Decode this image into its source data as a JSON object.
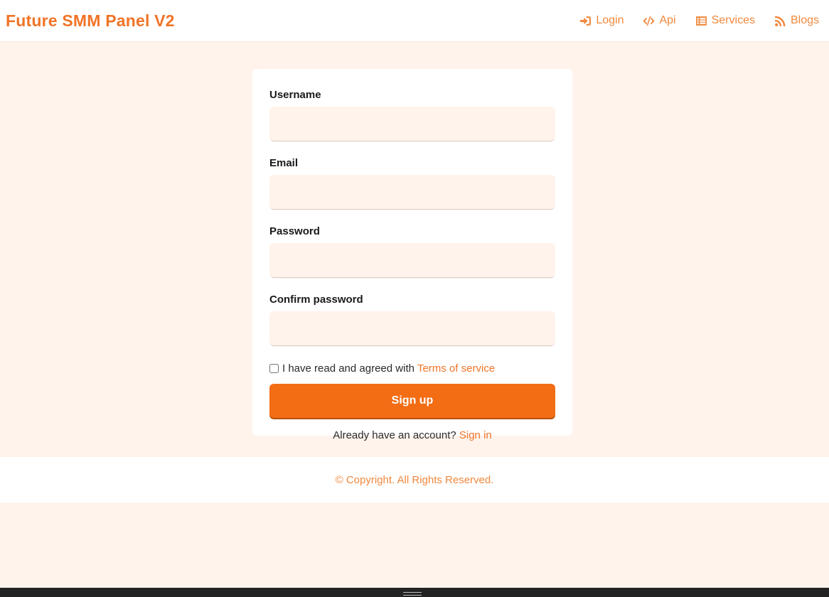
{
  "header": {
    "brand": "Future SMM Panel V2",
    "nav": [
      {
        "label": "Login",
        "icon": "sign-in-icon"
      },
      {
        "label": "Api",
        "icon": "code-icon"
      },
      {
        "label": "Services",
        "icon": "list-icon"
      },
      {
        "label": "Blogs",
        "icon": "rss-icon"
      }
    ]
  },
  "form": {
    "username_label": "Username",
    "username_value": "",
    "email_label": "Email",
    "email_value": "",
    "password_label": "Password",
    "password_value": "",
    "confirm_label": "Confirm password",
    "confirm_value": "",
    "terms_text": "I have read and agreed with",
    "terms_link": "Terms of service",
    "terms_checked": false,
    "submit_label": "Sign up",
    "signin_text": "Already have an account?",
    "signin_link": "Sign in"
  },
  "footer": {
    "copyright": "© Copyright. All Rights Reserved."
  },
  "colors": {
    "accent": "#f36d15",
    "link": "#f07427",
    "background": "#fff3ec"
  }
}
